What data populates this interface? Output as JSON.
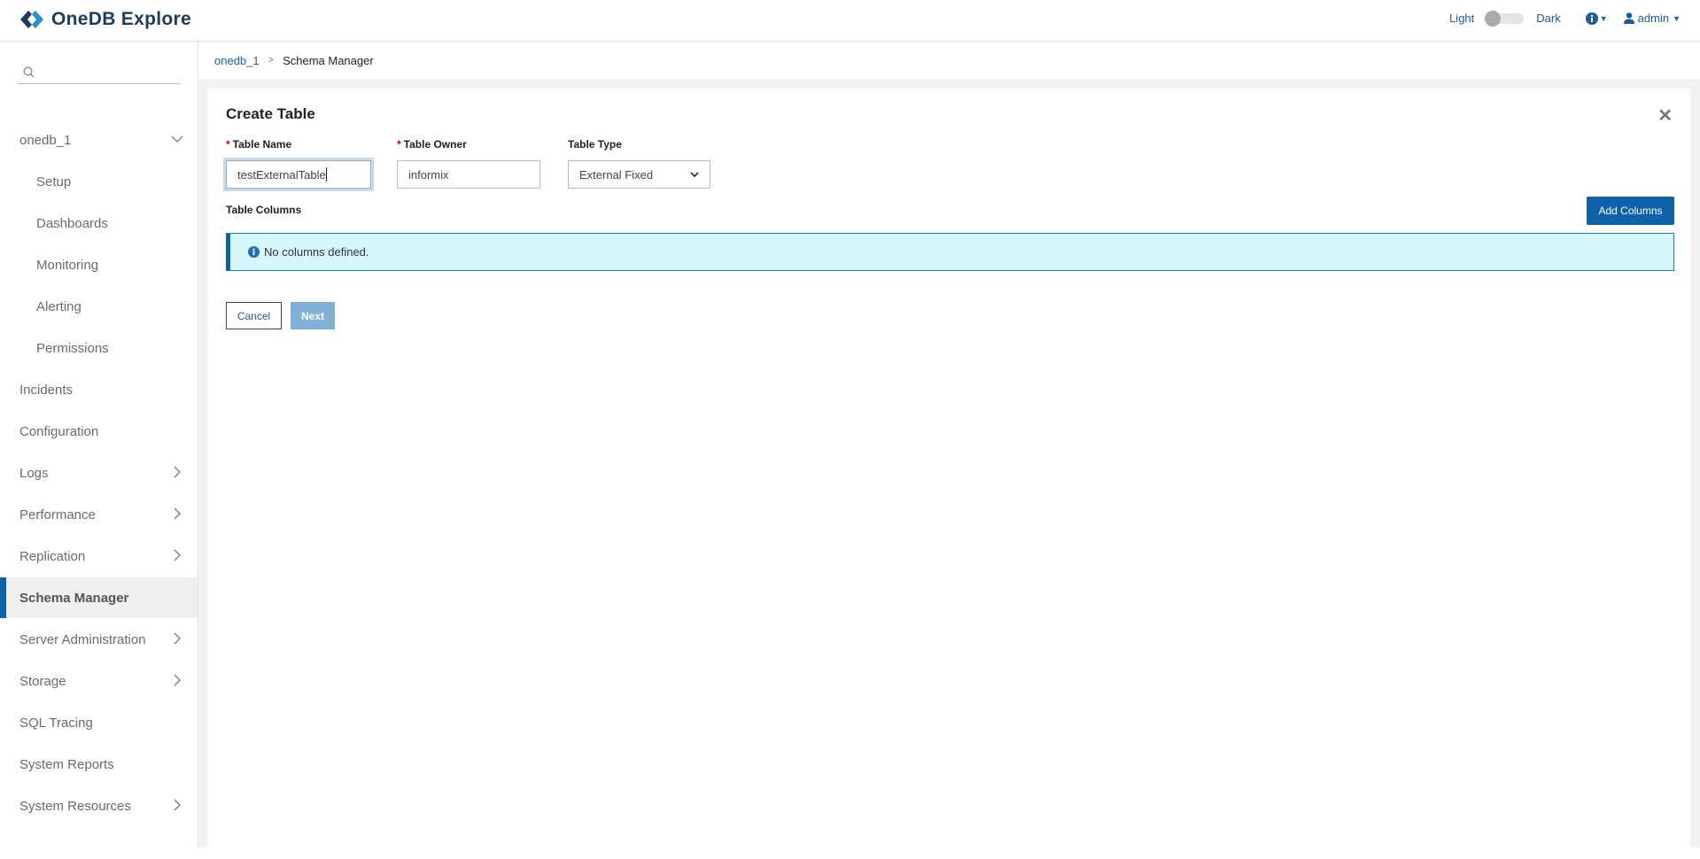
{
  "app": {
    "title": "OneDB Explore"
  },
  "header": {
    "theme_light": "Light",
    "theme_dark": "Dark",
    "user": "admin"
  },
  "sidebar": {
    "search_placeholder": "",
    "items": [
      {
        "label": "onedb_1",
        "expand": "down"
      },
      {
        "label": "Setup",
        "sub": true
      },
      {
        "label": "Dashboards",
        "sub": true
      },
      {
        "label": "Monitoring",
        "sub": true
      },
      {
        "label": "Alerting",
        "sub": true
      },
      {
        "label": "Permissions",
        "sub": true
      },
      {
        "label": "Incidents"
      },
      {
        "label": "Configuration"
      },
      {
        "label": "Logs",
        "expand": "right"
      },
      {
        "label": "Performance",
        "expand": "right"
      },
      {
        "label": "Replication",
        "expand": "right"
      },
      {
        "label": "Schema Manager",
        "active": true
      },
      {
        "label": "Server Administration",
        "expand": "right"
      },
      {
        "label": "Storage",
        "expand": "right"
      },
      {
        "label": "SQL Tracing"
      },
      {
        "label": "System Reports"
      },
      {
        "label": "System Resources",
        "expand": "right"
      }
    ]
  },
  "breadcrumb": {
    "root": "onedb_1",
    "sep": ">",
    "current": "Schema Manager"
  },
  "form": {
    "title": "Create Table",
    "table_name_label": "Table Name",
    "table_name_value": "testExternalTable",
    "table_owner_label": "Table Owner",
    "table_owner_value": "informix",
    "table_type_label": "Table Type",
    "table_type_value": "External Fixed",
    "required_mark": "*",
    "columns_label": "Table Columns",
    "add_columns": "Add Columns",
    "alert": "No columns defined.",
    "cancel": "Cancel",
    "next": "Next"
  }
}
